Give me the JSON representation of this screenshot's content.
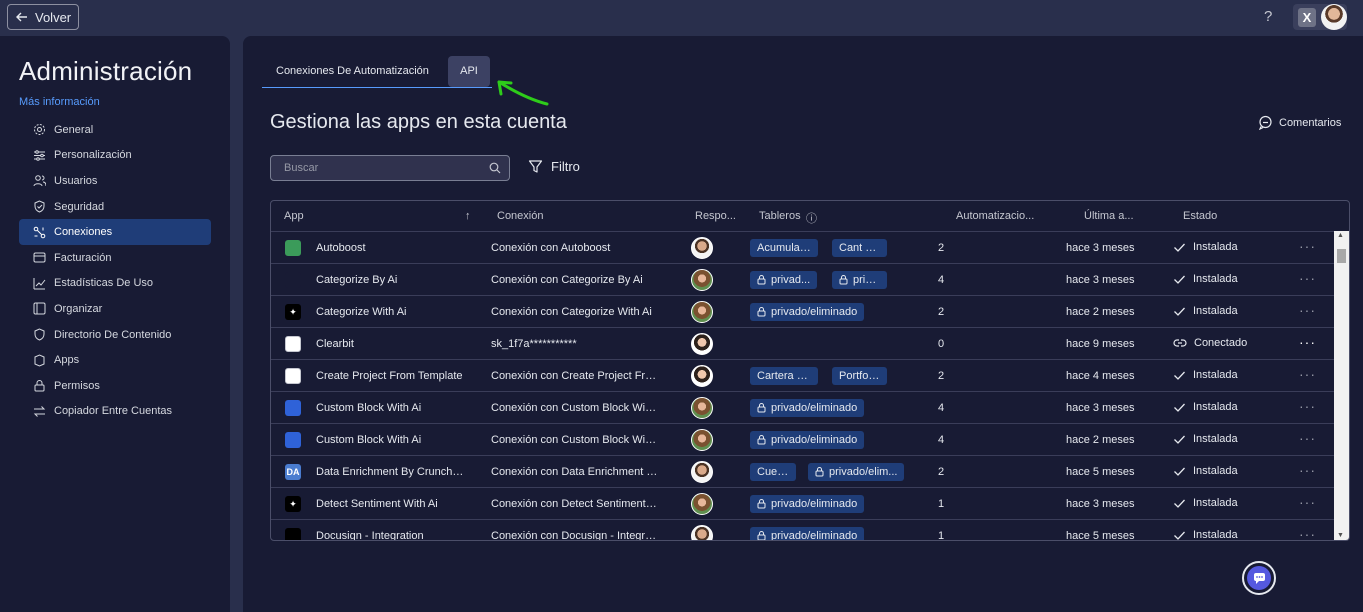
{
  "topbar": {
    "back_label": "Volver",
    "help_label": "?",
    "workspace_badge": "X"
  },
  "sidebar": {
    "title": "Administración",
    "more_info": "Más información",
    "items": [
      {
        "label": "General",
        "icon": "gear-icon"
      },
      {
        "label": "Personalización",
        "icon": "sliders-icon"
      },
      {
        "label": "Usuarios",
        "icon": "users-icon"
      },
      {
        "label": "Seguridad",
        "icon": "shield-icon"
      },
      {
        "label": "Conexiones",
        "icon": "connections-icon",
        "active": true
      },
      {
        "label": "Facturación",
        "icon": "billing-icon"
      },
      {
        "label": "Estadísticas De Uso",
        "icon": "stats-icon"
      },
      {
        "label": "Organizar",
        "icon": "organize-icon"
      },
      {
        "label": "Directorio De Contenido",
        "icon": "directory-icon"
      },
      {
        "label": "Apps",
        "icon": "apps-icon"
      },
      {
        "label": "Permisos",
        "icon": "lock-icon"
      },
      {
        "label": "Copiador Entre Cuentas",
        "icon": "swap-icon"
      }
    ]
  },
  "main": {
    "tabs": [
      {
        "label": "Conexiones De Automatización"
      },
      {
        "label": "API"
      }
    ],
    "heading": "Gestiona las apps en esta cuenta",
    "feedback_label": "Comentarios",
    "search_placeholder": "Buscar",
    "filter_label": "Filtro"
  },
  "table": {
    "headers": {
      "app": "App",
      "sort": "↑",
      "connection": "Conexión",
      "owner": "Respo...",
      "boards": "Tableros",
      "info": "ⓘ",
      "automations": "Automatizacio...",
      "last": "Última a...",
      "status": "Estado"
    },
    "rows": [
      {
        "app": "Autoboost",
        "icon_color": "#3b9b5a",
        "icon_text": "",
        "connection": "Conexión con Autoboost",
        "owner": "m",
        "boards": [
          {
            "label": "Acumulado",
            "lock": false
          },
          {
            "label": "Cant PR",
            "lock": false
          }
        ],
        "automations": "2",
        "last": "hace 3 meses",
        "status": "Instalada"
      },
      {
        "app": "Categorize By Ai",
        "icon_color": "#181b34",
        "icon_text": "",
        "connection": "Conexión con Categorize By Ai",
        "owner": "f",
        "boards": [
          {
            "label": "privad...",
            "lock": true
          },
          {
            "label": "privad...",
            "lock": true
          }
        ],
        "automations": "4",
        "last": "hace 3 meses",
        "status": "Instalada"
      },
      {
        "app": "Categorize With Ai",
        "icon_color": "#000000",
        "icon_text": "✦",
        "connection": "Conexión con Categorize With Ai",
        "owner": "f",
        "boards": [
          {
            "label": "privado/eliminado",
            "lock": true
          }
        ],
        "automations": "2",
        "last": "hace 2 meses",
        "status": "Instalada"
      },
      {
        "app": "Clearbit",
        "icon_color": "#ffffff",
        "icon_text": "",
        "connection": "sk_1f7a***********",
        "owner": "w",
        "boards": [],
        "automations": "0",
        "last": "hace 9 meses",
        "status": "Conectado"
      },
      {
        "app": "Create Project From Template",
        "icon_color": "#ffffff",
        "icon_text": "",
        "connection": "Conexión con Create Project From Template",
        "owner": "w",
        "boards": [
          {
            "label": "Cartera d...",
            "lock": false
          },
          {
            "label": "Portfolio ...",
            "lock": false
          }
        ],
        "automations": "2",
        "last": "hace 4 meses",
        "status": "Instalada"
      },
      {
        "app": "Custom Block With Ai",
        "icon_color": "#2f62d8",
        "icon_text": "",
        "connection": "Conexión con Custom Block With Ai",
        "owner": "f",
        "boards": [
          {
            "label": "privado/eliminado",
            "lock": true
          }
        ],
        "automations": "4",
        "last": "hace 3 meses",
        "status": "Instalada"
      },
      {
        "app": "Custom Block With Ai",
        "icon_color": "#2f62d8",
        "icon_text": "",
        "connection": "Conexión con Custom Block With Ai",
        "owner": "f",
        "boards": [
          {
            "label": "privado/eliminado",
            "lock": true
          }
        ],
        "automations": "4",
        "last": "hace 2 meses",
        "status": "Instalada"
      },
      {
        "app": "Data Enrichment By Crunchbase",
        "icon_color": "#4a7ccf",
        "icon_text": "DA",
        "connection": "Conexión con Data Enrichment By Crunchbase",
        "owner": "m",
        "boards": [
          {
            "label": "Cuen...",
            "lock": false
          },
          {
            "label": "privado/elim...",
            "lock": true
          }
        ],
        "automations": "2",
        "last": "hace 5 meses",
        "status": "Instalada"
      },
      {
        "app": "Detect Sentiment With Ai",
        "icon_color": "#000000",
        "icon_text": "✦",
        "connection": "Conexión con Detect Sentiment With Ai",
        "owner": "f",
        "boards": [
          {
            "label": "privado/eliminado",
            "lock": true
          }
        ],
        "automations": "1",
        "last": "hace 3 meses",
        "status": "Instalada"
      },
      {
        "app": "Docusign - Integration",
        "icon_color": "#000000",
        "icon_text": "",
        "connection": "Conexión con Docusign - Integration",
        "owner": "m",
        "boards": [
          {
            "label": "privado/eliminado",
            "lock": true
          }
        ],
        "automations": "1",
        "last": "hace 5 meses",
        "status": "Instalada"
      }
    ]
  }
}
